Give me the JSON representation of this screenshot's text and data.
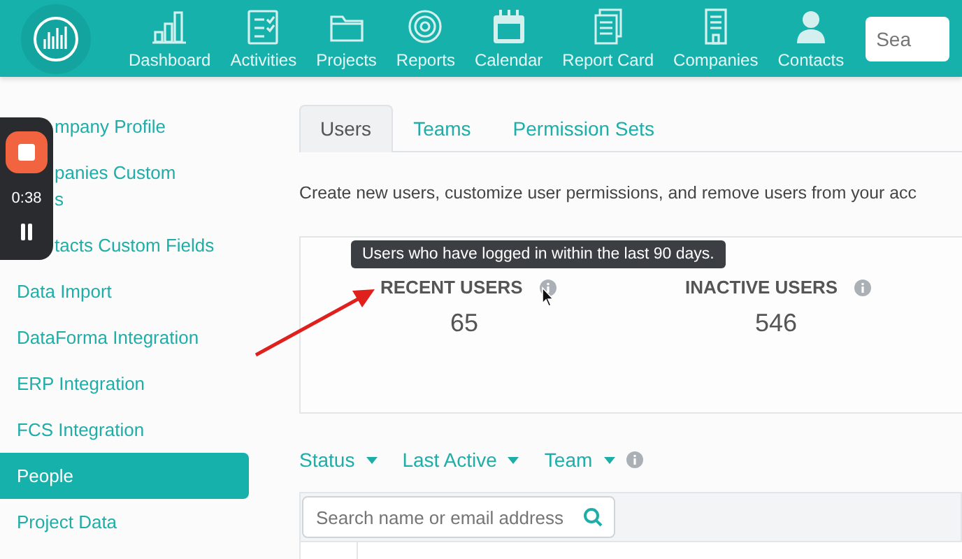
{
  "nav": {
    "items": [
      {
        "label": "Dashboard"
      },
      {
        "label": "Activities"
      },
      {
        "label": "Projects"
      },
      {
        "label": "Reports"
      },
      {
        "label": "Calendar"
      },
      {
        "label": "Report Card"
      },
      {
        "label": "Companies"
      },
      {
        "label": "Contacts"
      }
    ],
    "search": {
      "placeholder": "Sea"
    }
  },
  "sidebar": {
    "items": [
      {
        "label": "mpany Profile",
        "selected": false
      },
      {
        "label": "panies Custom\ns",
        "selected": false
      },
      {
        "label": "tacts Custom Fields",
        "selected": false
      },
      {
        "label": "Data Import",
        "selected": false
      },
      {
        "label": "DataForma Integration",
        "selected": false
      },
      {
        "label": "ERP Integration",
        "selected": false
      },
      {
        "label": "FCS Integration",
        "selected": false
      },
      {
        "label": "People",
        "selected": true
      },
      {
        "label": "Project Data",
        "selected": false
      }
    ]
  },
  "recorder": {
    "time": "0:38"
  },
  "tabs": [
    {
      "label": "Users",
      "selected": true
    },
    {
      "label": "Teams",
      "selected": false
    },
    {
      "label": "Permission Sets",
      "selected": false
    }
  ],
  "description": "Create new users, customize user permissions, and remove users from your acc",
  "tooltip": "Users who have logged in within the last 90 days.",
  "stats": [
    {
      "label": "RECENT USERS",
      "value": "65"
    },
    {
      "label": "INACTIVE USERS",
      "value": "546"
    }
  ],
  "filters": [
    {
      "label": "Status"
    },
    {
      "label": "Last Active"
    },
    {
      "label": "Team"
    }
  ],
  "user_search": {
    "placeholder": "Search name or email address"
  }
}
